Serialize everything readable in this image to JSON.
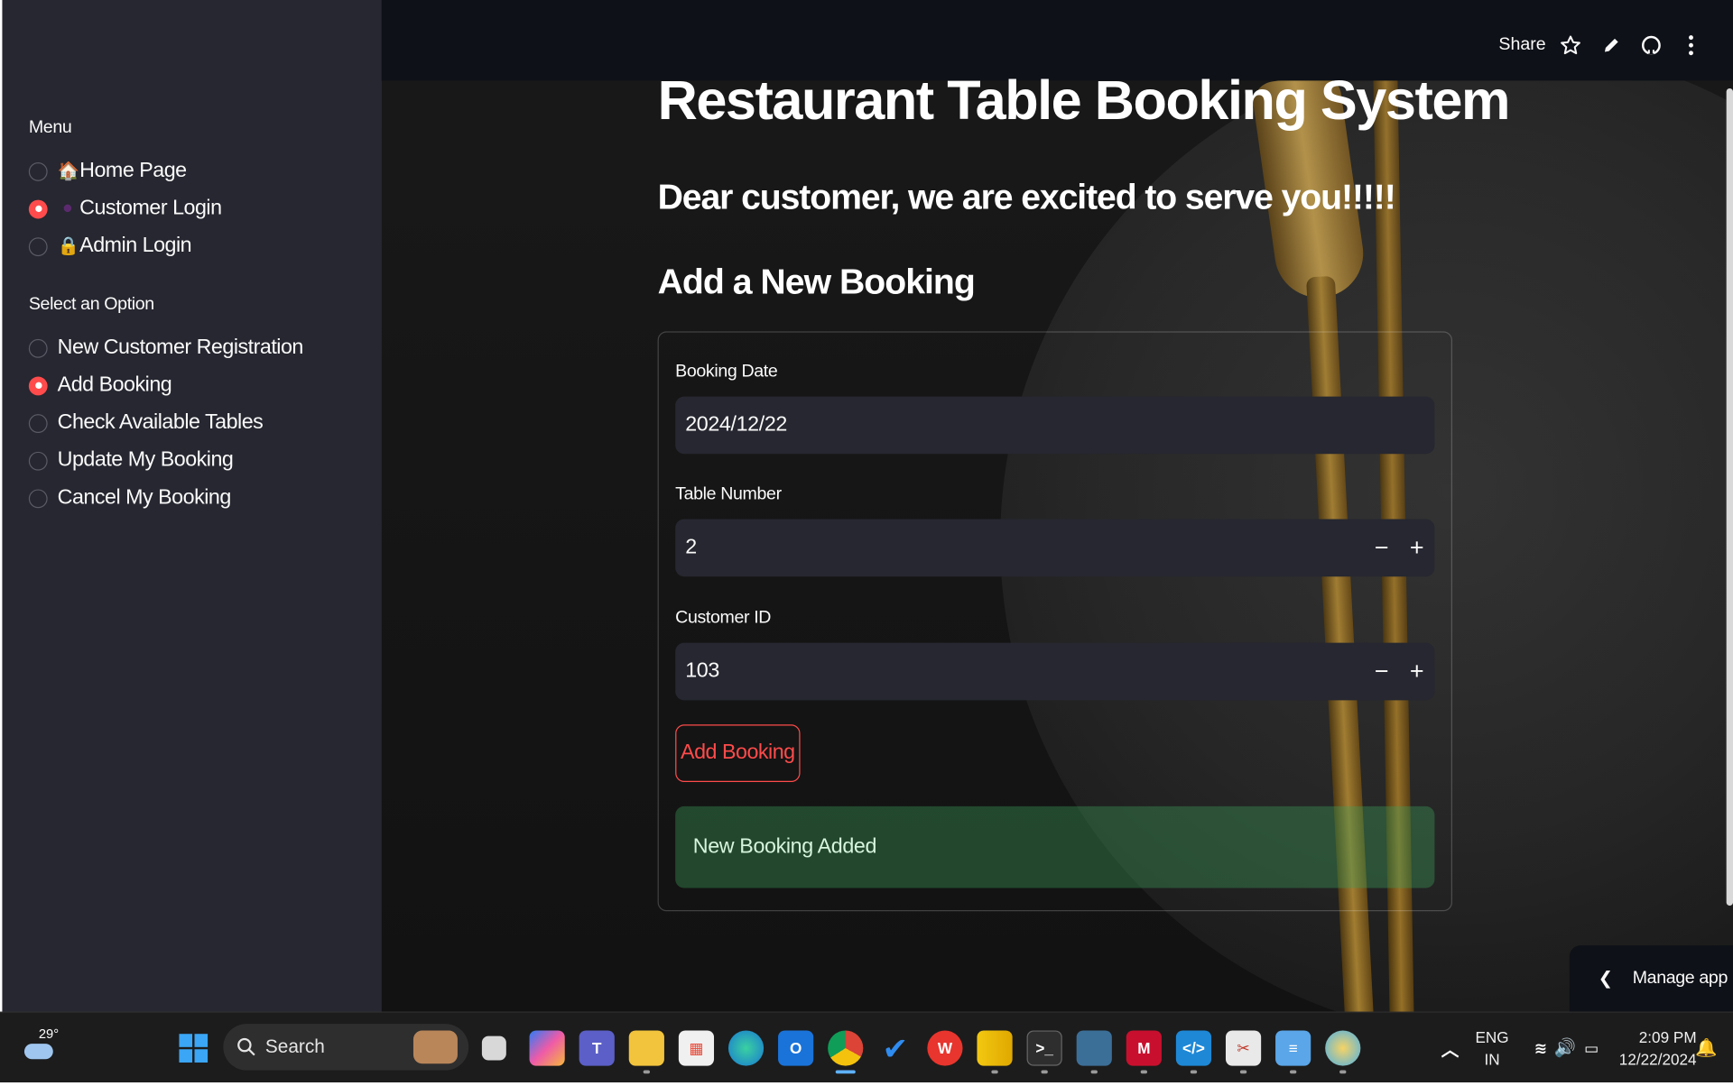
{
  "sidebar": {
    "menu_heading": "Menu",
    "menu_items": [
      {
        "label": "Home Page",
        "icon": "house-icon",
        "selected": false
      },
      {
        "label": "Customer Login",
        "icon": "person-icon",
        "selected": true
      },
      {
        "label": "Admin Login",
        "icon": "lock-icon",
        "selected": false
      }
    ],
    "option_heading": "Select an Option",
    "option_items": [
      {
        "label": "New Customer Registration",
        "selected": false
      },
      {
        "label": "Add Booking",
        "selected": true
      },
      {
        "label": "Check Available Tables",
        "selected": false
      },
      {
        "label": "Update My Booking",
        "selected": false
      },
      {
        "label": "Cancel My Booking",
        "selected": false
      }
    ]
  },
  "header": {
    "share_label": "Share",
    "icons": [
      "star-icon",
      "pencil-icon",
      "github-icon",
      "more-vert-icon"
    ]
  },
  "main": {
    "title": "Restaurant Table Booking System",
    "subtitle": "Dear customer, we are excited to serve you!!!!!",
    "section_title": "Add a New Booking",
    "form": {
      "booking_date_label": "Booking Date",
      "booking_date_value": "2024/12/22",
      "table_number_label": "Table Number",
      "table_number_value": "2",
      "customer_id_label": "Customer ID",
      "customer_id_value": "103",
      "submit_label": "Add Booking"
    },
    "success_message": "New Booking Added",
    "manage_app_label": "Manage app"
  },
  "taskbar": {
    "weather_temp": "29°",
    "search_label": "Search",
    "language": "ENG",
    "region": "IN",
    "time": "2:09 PM",
    "date": "12/22/2024"
  },
  "colors": {
    "accent": "#ff4b4b",
    "sidebar_bg": "#262730",
    "header_bg": "#0e1117",
    "success_bg": "#2a5a38"
  }
}
